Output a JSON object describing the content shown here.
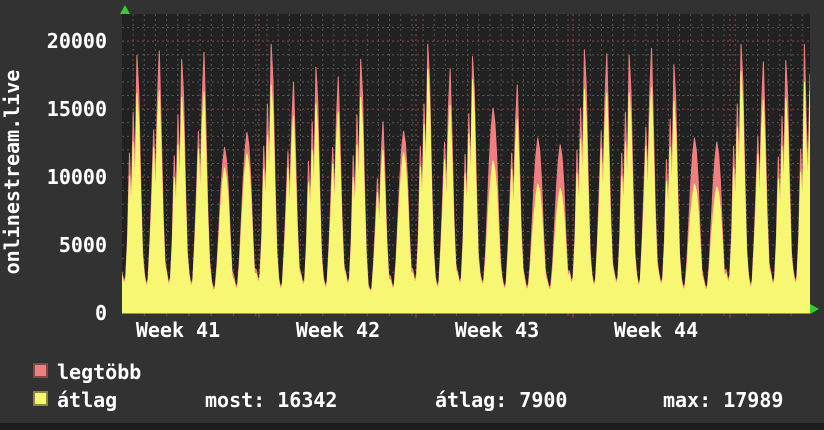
{
  "app": {
    "vertical_title": "onlinestream.live"
  },
  "colors": {
    "background": "#323232",
    "plot_background": "#212121",
    "minor_grid": "#565656",
    "major_grid": "#a04545",
    "text": "#ffffff",
    "arrow_green": "#30d030",
    "series_max": "#f08080",
    "series_avg": "#f7f773"
  },
  "legend": {
    "series1_label": "legtöbb",
    "series2_label": "átlag",
    "stat_most": "most: 16342",
    "stat_avg": "átlag: 7900",
    "stat_max": "max: 17989"
  },
  "chart_data": {
    "type": "area",
    "title": "onlinestream.live",
    "x_axis": {
      "labels": [
        "Week 41",
        "Week 42",
        "Week 43",
        "Week 44"
      ],
      "minor_grid_interval": "12 hours",
      "major_grid_interval": "1 week"
    },
    "y_axis": {
      "tick_labels": [
        "0",
        "5000",
        "10000",
        "15000",
        "20000"
      ],
      "ticks": [
        0,
        5000,
        10000,
        15000,
        20000
      ],
      "minor_grid_interval": 1000,
      "major_grid_interval": 5000,
      "ylim": [
        0,
        22000
      ]
    },
    "grid": true,
    "legend_position": "bottom-left",
    "stats": {
      "most": 16342,
      "atlag": 7900,
      "max": 17989
    },
    "sample_step_hours": 2,
    "series": [
      {
        "name": "legtöbb",
        "color": "#f08080",
        "values": [
          3000,
          2300,
          2700,
          5700,
          11800,
          8400,
          14800,
          10500,
          19000,
          16300,
          9900,
          4600,
          2900,
          2100,
          2500,
          5400,
          9300,
          13500,
          9700,
          15800,
          19300,
          13900,
          7700,
          3900,
          3000,
          2200,
          2600,
          5600,
          11600,
          8200,
          14600,
          10300,
          18700,
          16100,
          9700,
          4500,
          2900,
          2100,
          2500,
          5400,
          9200,
          13400,
          9600,
          15700,
          19200,
          13800,
          7700,
          3800,
          2400,
          1800,
          2000,
          3700,
          6300,
          9000,
          11000,
          12200,
          11300,
          9300,
          5900,
          3100,
          2700,
          2000,
          2100,
          4000,
          6900,
          9800,
          12000,
          13300,
          12400,
          10100,
          6400,
          3300,
          3200,
          2400,
          2800,
          5900,
          12300,
          8700,
          15400,
          10900,
          19800,
          17000,
          10300,
          4800,
          2600,
          1900,
          2200,
          4800,
          8200,
          11900,
          8500,
          13900,
          17000,
          12200,
          6800,
          3400,
          2900,
          2200,
          2500,
          5400,
          11200,
          8000,
          14100,
          10000,
          18100,
          15600,
          9400,
          4300,
          2600,
          2000,
          2300,
          4900,
          8400,
          12200,
          8700,
          14300,
          17400,
          12500,
          7000,
          3500,
          3000,
          2200,
          2600,
          5600,
          11600,
          8200,
          14600,
          10300,
          18700,
          16100,
          9700,
          4500,
          2100,
          1700,
          1800,
          3900,
          6800,
          9900,
          7100,
          11600,
          14100,
          10200,
          5600,
          2800,
          2700,
          2000,
          2100,
          4000,
          7000,
          9900,
          12100,
          13400,
          12500,
          10200,
          6400,
          3400,
          3200,
          2400,
          2800,
          5900,
          12300,
          8700,
          15400,
          10900,
          19800,
          17000,
          10300,
          4800,
          2700,
          2000,
          2300,
          5000,
          8600,
          12600,
          9000,
          14800,
          18000,
          13000,
          7200,
          3600,
          3000,
          2300,
          2600,
          5700,
          11700,
          8300,
          14700,
          10400,
          18900,
          16300,
          9800,
          4500,
          3000,
          2300,
          2400,
          4500,
          7900,
          11200,
          13600,
          15100,
          14000,
          11500,
          7200,
          3800,
          2500,
          1900,
          2200,
          4700,
          8100,
          11800,
          8400,
          13800,
          16800,
          12100,
          6700,
          3400,
          2600,
          1900,
          2100,
          3900,
          6700,
          9500,
          11600,
          12900,
          12000,
          9800,
          6200,
          3200,
          2500,
          1900,
          2000,
          3700,
          6400,
          9200,
          11200,
          12400,
          11500,
          9400,
          6000,
          3100,
          3100,
          2300,
          2700,
          5800,
          12000,
          8500,
          15100,
          10700,
          19400,
          16700,
          10100,
          4700,
          2900,
          2100,
          2500,
          5300,
          9200,
          13400,
          9600,
          15700,
          19100,
          13800,
          7600,
          3800,
          3000,
          2300,
          2700,
          5700,
          11800,
          8400,
          14800,
          10500,
          19000,
          16300,
          9900,
          4600,
          2900,
          2100,
          2500,
          5500,
          9400,
          13700,
          9800,
          16000,
          19500,
          14000,
          7800,
          3900,
          2900,
          2200,
          2600,
          5500,
          11300,
          8100,
          14300,
          10100,
          18300,
          15700,
          9500,
          4400,
          2600,
          1900,
          2100,
          3900,
          6700,
          9500,
          11600,
          12900,
          12000,
          9800,
          6200,
          3200,
          2500,
          1900,
          2000,
          3800,
          6600,
          9300,
          11300,
          12600,
          11700,
          9600,
          6100,
          3100,
          3200,
          2400,
          2800,
          5900,
          12300,
          8700,
          15400,
          10900,
          19800,
          17000,
          10300,
          4800,
          2800,
          2000,
          2400,
          5200,
          8900,
          13000,
          9300,
          15200,
          18500,
          13300,
          7400,
          3700,
          3000,
          2200,
          2600,
          5600,
          11500,
          8200,
          14500,
          10200,
          18600,
          16000,
          9700,
          4500,
          3100,
          2300,
          2700,
          5800,
          12100,
          8600,
          19800,
          14000,
          10500,
          17600
        ]
      },
      {
        "name": "átlag",
        "color": "#f7f773",
        "values": [
          2800,
          2100,
          2500,
          5100,
          10100,
          7600,
          12600,
          9200,
          16200,
          13900,
          8700,
          4100,
          2700,
          1900,
          2300,
          4900,
          8000,
          12200,
          8200,
          13900,
          16400,
          11800,
          6800,
          3500,
          2800,
          2000,
          2400,
          5000,
          10000,
          7400,
          12400,
          9100,
          15900,
          13700,
          8500,
          4100,
          2700,
          1900,
          2300,
          4900,
          7900,
          12100,
          8200,
          13800,
          16300,
          11700,
          6800,
          3400,
          2200,
          1600,
          1800,
          3300,
          5500,
          7900,
          9700,
          10700,
          9900,
          8200,
          5200,
          2700,
          2400,
          1800,
          1900,
          3500,
          6100,
          8600,
          10600,
          11700,
          10900,
          8900,
          5600,
          2900,
          2900,
          2200,
          2600,
          5300,
          10600,
          7800,
          13100,
          9600,
          16800,
          14500,
          9100,
          4300,
          2400,
          1700,
          2000,
          4300,
          7100,
          10700,
          7200,
          12200,
          14500,
          10400,
          6000,
          3100,
          2700,
          2000,
          2300,
          4900,
          9600,
          7200,
          12000,
          8800,
          15400,
          13300,
          8300,
          3900,
          2400,
          1800,
          2100,
          4400,
          7200,
          11000,
          7400,
          12600,
          14800,
          10600,
          6200,
          3200,
          2800,
          2000,
          2400,
          5000,
          10000,
          7400,
          12400,
          9100,
          15900,
          13700,
          8500,
          4100,
          1900,
          1600,
          1700,
          3500,
          5800,
          8900,
          6000,
          10200,
          12000,
          8700,
          4900,
          2500,
          2400,
          1800,
          1900,
          3500,
          6200,
          8700,
          10600,
          11800,
          11000,
          9000,
          5600,
          3000,
          2900,
          2200,
          2600,
          5300,
          10800,
          7900,
          13900,
          9900,
          17989,
          15300,
          9200,
          4400,
          2500,
          1800,
          2100,
          4500,
          7400,
          11300,
          7700,
          13000,
          15300,
          11100,
          6300,
          3200,
          2800,
          2100,
          2400,
          5100,
          10300,
          7500,
          13200,
          9400,
          17200,
          14700,
          8800,
          4100,
          2700,
          2100,
          2200,
          3800,
          6300,
          8500,
          10100,
          11200,
          10500,
          9000,
          6000,
          3300,
          2300,
          1700,
          2000,
          4200,
          7000,
          10600,
          7100,
          12100,
          14300,
          10300,
          5900,
          3100,
          2300,
          1700,
          1900,
          3300,
          5400,
          7200,
          8600,
          9500,
          9000,
          7600,
          5200,
          2800,
          2300,
          1700,
          1800,
          3100,
          5100,
          7000,
          8300,
          9200,
          8600,
          7300,
          5000,
          2700,
          2900,
          2100,
          2500,
          5200,
          10300,
          7700,
          12800,
          9400,
          16500,
          14200,
          8900,
          4200,
          2700,
          1900,
          2300,
          4800,
          7900,
          12100,
          8200,
          13800,
          16200,
          11700,
          6700,
          3400,
          2800,
          2100,
          2500,
          5100,
          10100,
          7600,
          12600,
          9200,
          16200,
          13900,
          8700,
          4100,
          2700,
          1900,
          2300,
          5000,
          8100,
          12300,
          8300,
          14100,
          16600,
          11900,
          6900,
          3500,
          2700,
          2000,
          2400,
          5000,
          9700,
          7300,
          12200,
          8900,
          15600,
          13300,
          8400,
          4000,
          2300,
          1700,
          1900,
          3300,
          5400,
          7200,
          8600,
          9500,
          9000,
          7600,
          5200,
          2800,
          2300,
          1700,
          1800,
          3200,
          5300,
          7100,
          8400,
          9300,
          8800,
          7500,
          5100,
          2700,
          2900,
          2200,
          2600,
          5300,
          10700,
          7800,
          13700,
          9700,
          17800,
          15100,
          9100,
          4300,
          2600,
          1800,
          2200,
          4700,
          7700,
          11700,
          7900,
          13400,
          15700,
          11300,
          6500,
          3300,
          2800,
          2000,
          2400,
          5000,
          9900,
          7400,
          12300,
          9000,
          15800,
          13600,
          8500,
          4000,
          2900,
          2100,
          2500,
          5200,
          10400,
          7700,
          17000,
          12000,
          9400,
          16342
        ]
      }
    ]
  }
}
